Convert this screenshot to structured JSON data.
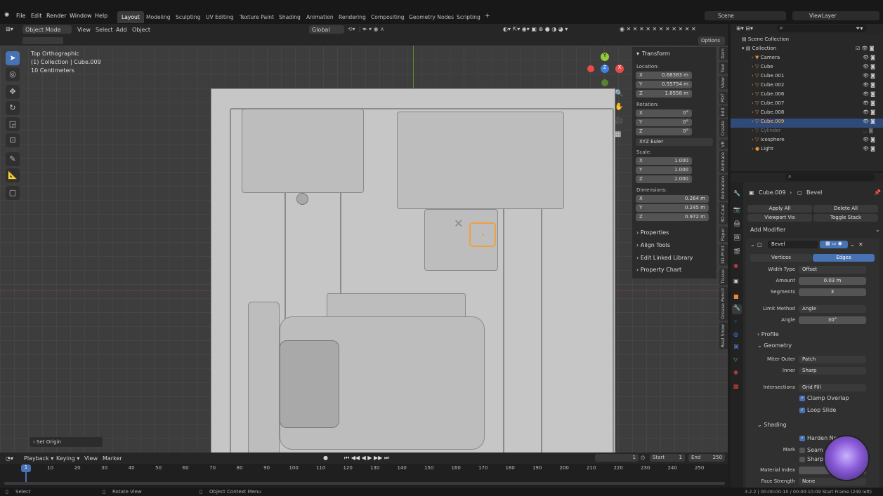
{
  "menu": [
    "File",
    "Edit",
    "Render",
    "Window",
    "Help"
  ],
  "workspaces": [
    "Layout",
    "Modeling",
    "Sculpting",
    "UV Editing",
    "Texture Paint",
    "Shading",
    "Animation",
    "Rendering",
    "Compositing",
    "Geometry Nodes",
    "Scripting"
  ],
  "scene": "Scene",
  "view_layer": "ViewLayer",
  "vp_header": {
    "mode": "Object Mode",
    "view": "View",
    "select": "Select",
    "add": "Add",
    "object": "Object",
    "orientation": "Global",
    "options": "Options"
  },
  "overlay_text": {
    "view": "Top Orthographic",
    "collection": "(1) Collection | Cube.009",
    "scale": "10 Centimeters"
  },
  "npanel": {
    "transform": "Transform",
    "location": "Location:",
    "rotation": "Rotation:",
    "scale": "Scale:",
    "dimensions": "Dimensions:",
    "loc": [
      "0.68383 m",
      "0.55754 m",
      "1.8558 m"
    ],
    "rot": [
      "0°",
      "0°",
      "0°"
    ],
    "rot_mode": "XYZ Euler",
    "scl": [
      "1.000",
      "1.000",
      "1.000"
    ],
    "dim": [
      "0.264 m",
      "0.245 m",
      "0.972 m"
    ],
    "axes": [
      "X",
      "Y",
      "Z"
    ],
    "sections": [
      "Properties",
      "Align Tools",
      "Edit Linked Library",
      "Property Chart"
    ]
  },
  "vtabs": [
    "Item",
    "Tool",
    "View",
    "PDT",
    "Edit",
    "Create",
    "VR",
    "Animate",
    "Animation",
    "3D-Coat",
    "Paper",
    "3D-Print",
    "Tissue",
    "Grease Pencil",
    "Real Snow"
  ],
  "outliner": {
    "root": "Scene Collection",
    "collection": "Collection",
    "items": [
      "Camera",
      "Cube",
      "Cube.001",
      "Cube.002",
      "Cube.006",
      "Cube.007",
      "Cube.008",
      "Cube.009",
      "Cylinder",
      "Icosphere",
      "Light"
    ]
  },
  "props": {
    "breadcrumb_obj": "Cube.009",
    "breadcrumb_mod": "Bevel",
    "apply_all": "Apply All",
    "delete_all": "Delete All",
    "viewport_vis": "Viewport Vis",
    "toggle_stack": "Toggle Stack",
    "add_modifier": "Add Modifier",
    "mod_name": "Bevel",
    "tab_vertices": "Vertices",
    "tab_edges": "Edges",
    "width_type_l": "Width Type",
    "width_type": "Offset",
    "amount_l": "Amount",
    "amount": "0.03 m",
    "segments_l": "Segments",
    "segments": "3",
    "limit_l": "Limit Method",
    "limit": "Angle",
    "angle_l": "Angle",
    "angle": "30°",
    "profile": "Profile",
    "geometry": "Geometry",
    "miter_outer_l": "Miter Outer",
    "miter_outer": "Patch",
    "inner_l": "Inner",
    "inner": "Sharp",
    "intersections_l": "Intersections",
    "intersections": "Grid Fill",
    "clamp": "Clamp Overlap",
    "loop_slide": "Loop Slide",
    "shading": "Shading",
    "harden": "Harden Norm",
    "mark_l": "Mark",
    "seam": "Seam",
    "sharp": "Sharp",
    "material_l": "Material Index",
    "face_strength_l": "Face Strength",
    "face_strength": "None"
  },
  "timeline": {
    "playback": "Playback",
    "keying": "Keying",
    "view": "View",
    "marker": "Marker",
    "current": "1",
    "start_l": "Start",
    "start": "1",
    "end_l": "End",
    "end": "250",
    "ticks": [
      "1",
      "10",
      "20",
      "30",
      "40",
      "50",
      "60",
      "70",
      "80",
      "90",
      "100",
      "110",
      "120",
      "130",
      "140",
      "150",
      "160",
      "170",
      "180",
      "190",
      "200",
      "210",
      "220",
      "230",
      "240",
      "250"
    ]
  },
  "operator_panel": "Set Origin",
  "status": {
    "select": "Select",
    "rotate": "Rotate View",
    "context": "Object Context Menu",
    "version": "3.2.2 | 00:00:00:10 / 00:00:10:09 Start Frame (249 left)"
  },
  "colors": {
    "accent": "#4772b3",
    "selection": "#f0a040",
    "x_axis": "#e94b4b",
    "y_axis": "#8fcb3a",
    "z_axis": "#3f7fe0"
  }
}
